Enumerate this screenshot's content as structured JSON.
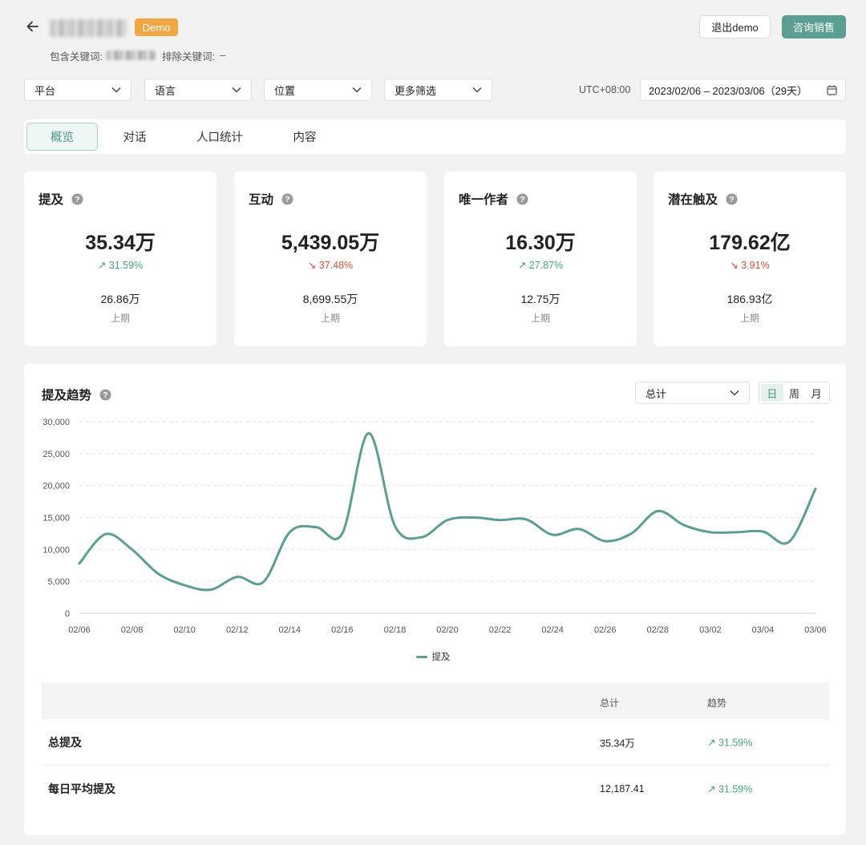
{
  "header": {
    "badge": "Demo",
    "include_label": "包含关键词:",
    "exclude_label": "排除关键词:",
    "exclude_value": "–",
    "exit_demo": "退出demo",
    "contact_sales": "咨询销售"
  },
  "filters": {
    "platform": "平台",
    "language": "语言",
    "location": "位置",
    "more": "更多筛选",
    "timezone": "UTC+08:00",
    "date_range": "2023/02/06 – 2023/03/06（29天）"
  },
  "tabs": [
    "概览",
    "对话",
    "人口统计",
    "内容"
  ],
  "cards": [
    {
      "title": "提及",
      "value": "35.34万",
      "change": "31.59%",
      "direction": "up",
      "prev": "26.86万",
      "prev_label": "上期"
    },
    {
      "title": "互动",
      "value": "5,439.05万",
      "change": "37.48%",
      "direction": "down",
      "prev": "8,699.55万",
      "prev_label": "上期"
    },
    {
      "title": "唯一作者",
      "value": "16.30万",
      "change": "27.87%",
      "direction": "up",
      "prev": "12.75万",
      "prev_label": "上期"
    },
    {
      "title": "潜在触及",
      "value": "179.62亿",
      "change": "3.91%",
      "direction": "down",
      "prev": "186.93亿",
      "prev_label": "上期"
    }
  ],
  "trend": {
    "title": "提及趋势",
    "metric_select": "总计",
    "periods": [
      "日",
      "周",
      "月"
    ],
    "active_period": 0
  },
  "chart_data": {
    "type": "line",
    "x": [
      "02/06",
      "02/07",
      "02/08",
      "02/09",
      "02/10",
      "02/11",
      "02/12",
      "02/13",
      "02/14",
      "02/15",
      "02/16",
      "02/17",
      "02/18",
      "02/19",
      "02/20",
      "02/21",
      "02/22",
      "02/23",
      "02/24",
      "02/25",
      "02/26",
      "02/27",
      "02/28",
      "03/01",
      "03/02",
      "03/03",
      "03/04",
      "03/05",
      "03/06"
    ],
    "x_tick_labels": [
      "02/06",
      "02/08",
      "02/10",
      "02/12",
      "02/14",
      "02/16",
      "02/18",
      "02/20",
      "02/22",
      "02/24",
      "02/26",
      "02/28",
      "03/02",
      "03/04",
      "03/06"
    ],
    "series": [
      {
        "name": "提及",
        "color": "#5a9f91",
        "values": [
          7800,
          12400,
          10000,
          6200,
          4400,
          3700,
          5700,
          4900,
          12700,
          13500,
          12500,
          28200,
          13700,
          11900,
          14600,
          15000,
          14600,
          14700,
          12300,
          13200,
          11300,
          12500,
          16000,
          13800,
          12700,
          12700,
          12800,
          11200,
          19500
        ]
      }
    ],
    "ylim": [
      0,
      30000
    ],
    "y_ticks": [
      "0",
      "5,000",
      "10,000",
      "15,000",
      "20,000",
      "25,000",
      "30,000"
    ],
    "grid": true,
    "legend_position": "bottom-center"
  },
  "table": {
    "headers": [
      "",
      "总计",
      "趋势"
    ],
    "rows": [
      {
        "name": "总提及",
        "total": "35.34万",
        "trend": "31.59%",
        "direction": "up"
      },
      {
        "name": "每日平均提及",
        "total": "12,187.41",
        "trend": "31.59%",
        "direction": "up"
      }
    ]
  },
  "colors": {
    "accent": "#5a9f91",
    "up": "#4aa186",
    "down": "#d9503c",
    "badge": "#f0a744"
  }
}
